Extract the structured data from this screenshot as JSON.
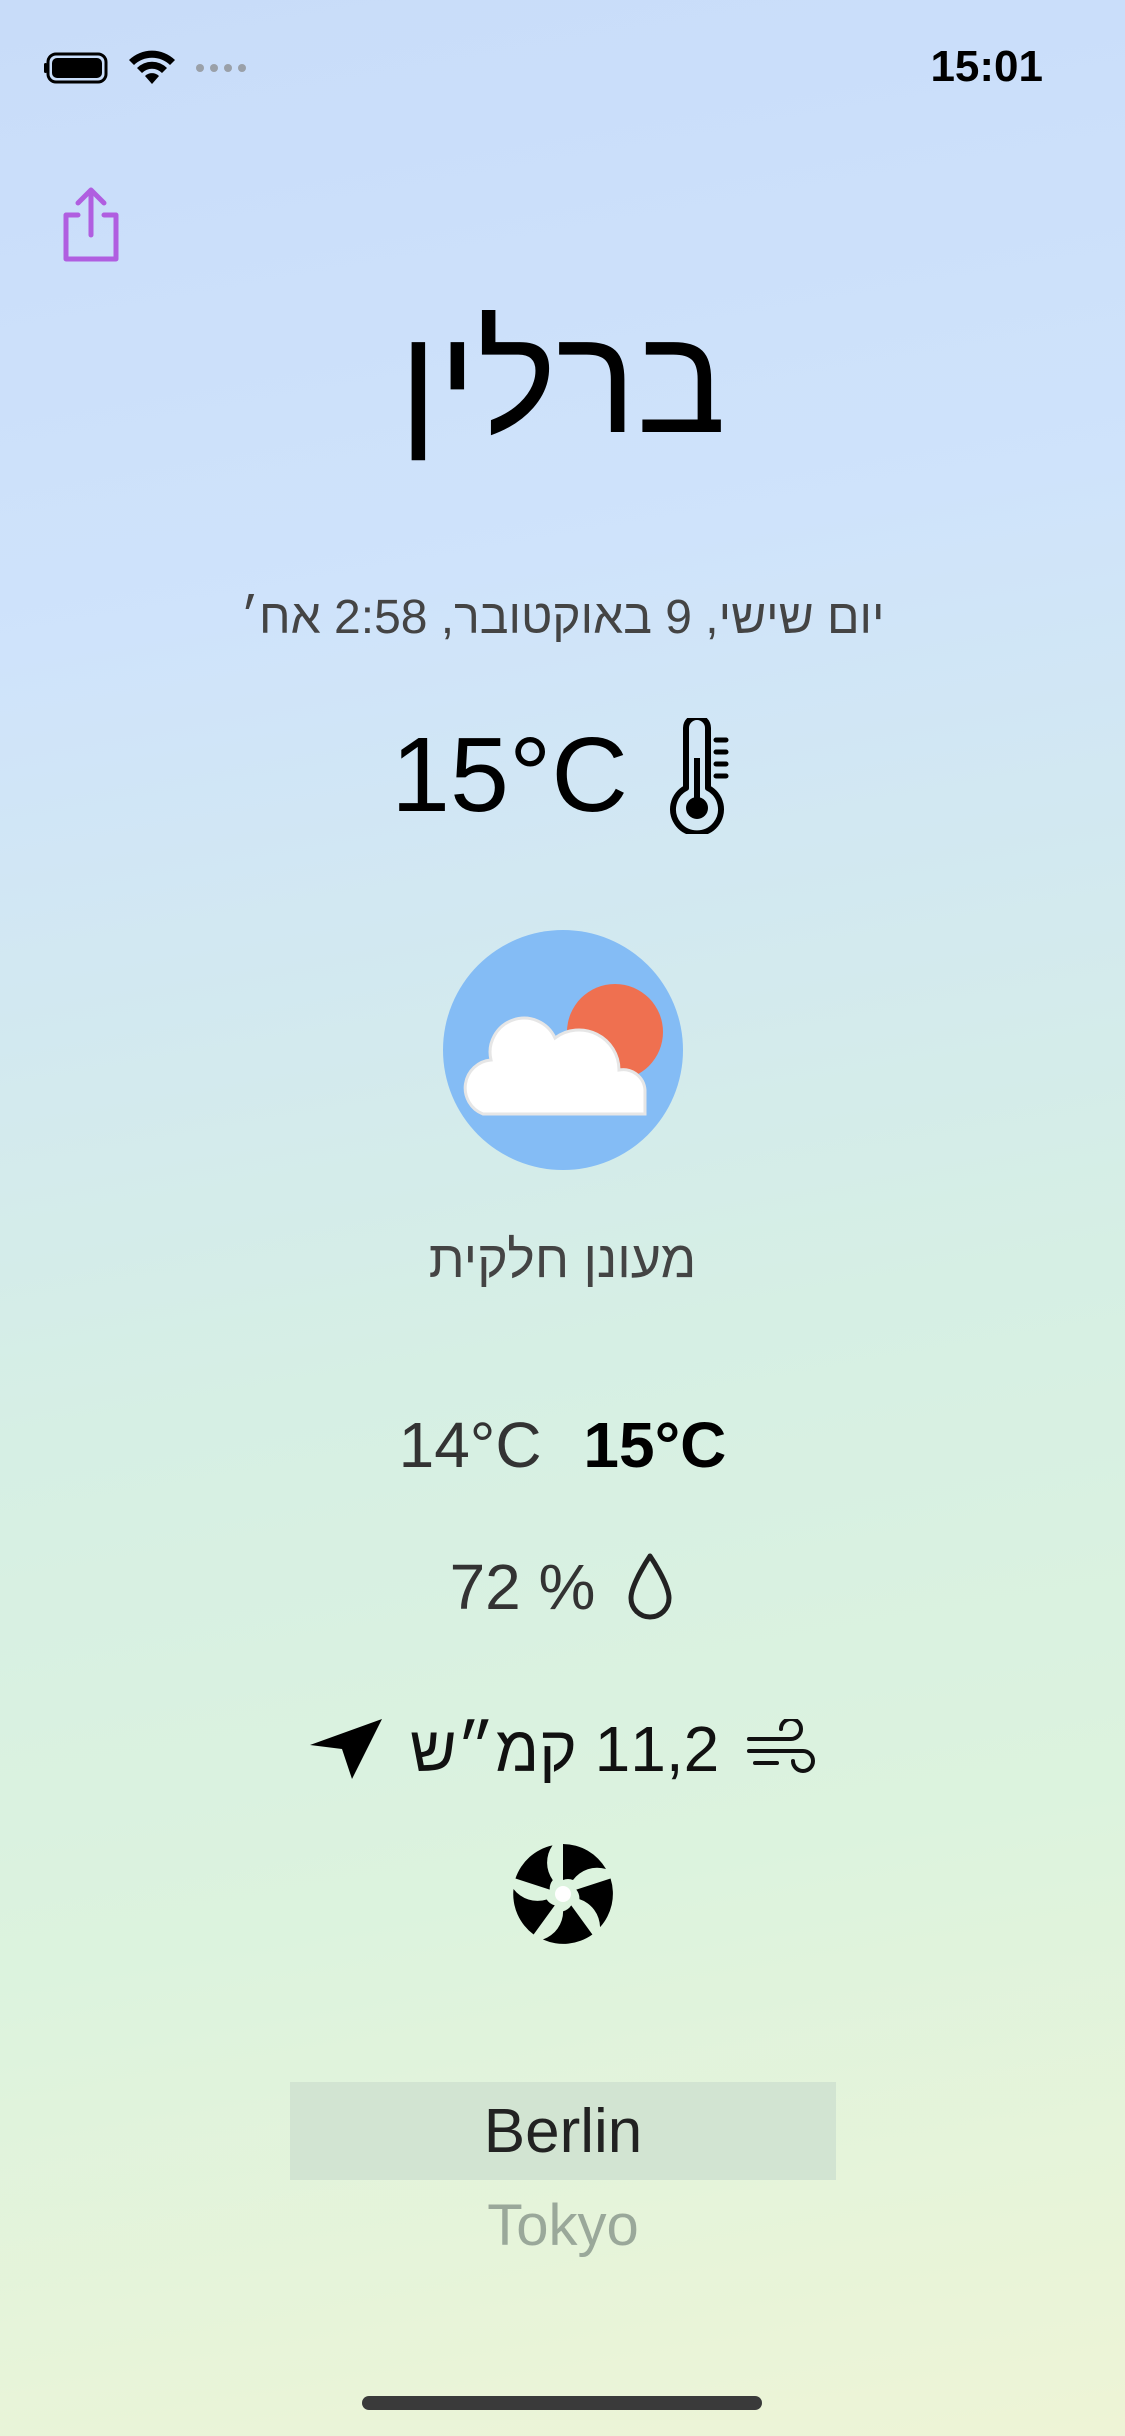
{
  "status_bar": {
    "time": "15:01"
  },
  "weather": {
    "city": "ברלין",
    "date_time": "יום שישי, 9 באוקטובר, 2:58 אח׳",
    "temperature": "15°C",
    "condition": "מעונן חלקית",
    "temp_min": "14°C",
    "temp_max": "15°C",
    "humidity": "72 %",
    "wind": "11,2 קמ״ש"
  },
  "city_picker": {
    "selected": "Berlin",
    "next": "Tokyo"
  },
  "colors": {
    "share_accent": "#b05ee0",
    "icon_circle": "#84bcf5",
    "sun": "#ef7050",
    "picker_highlight": "#d2e4d2"
  },
  "icons": [
    "battery-icon",
    "wifi-icon",
    "share-icon",
    "thermometer-icon",
    "partly-cloudy-icon",
    "droplet-icon",
    "wind-icon",
    "navigation-arrow-icon",
    "fan-icon"
  ]
}
